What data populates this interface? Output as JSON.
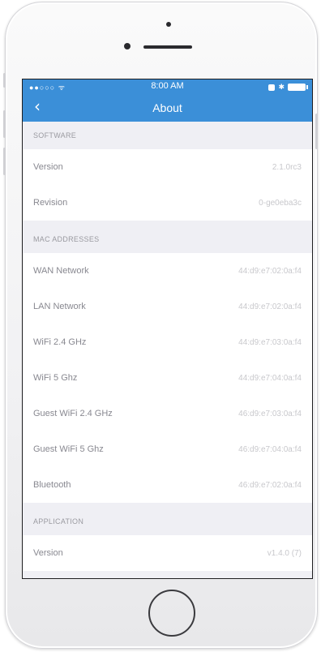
{
  "status": {
    "signal": "●●○○○ ",
    "wifi": "ᯤ",
    "time": "8:00 AM",
    "bluetooth": "✱"
  },
  "nav": {
    "back_glyph": "‹",
    "title": "About"
  },
  "sections": {
    "software": {
      "header": "SOFTWARE",
      "rows": [
        {
          "label": "Version",
          "value": "2.1.0rc3"
        },
        {
          "label": "Revision",
          "value": "0-ge0eba3c"
        }
      ]
    },
    "mac": {
      "header": "MAC ADDRESSES",
      "rows": [
        {
          "label": "WAN Network",
          "value": "44:d9:e7:02:0a:f4"
        },
        {
          "label": "LAN Network",
          "value": "44:d9:e7:02:0a:f4"
        },
        {
          "label": "WiFi 2.4 GHz",
          "value": "44:d9:e7:03:0a:f4"
        },
        {
          "label": "WiFi 5 Ghz",
          "value": "44:d9:e7:04:0a:f4"
        },
        {
          "label": "Guest WiFi 2.4 GHz",
          "value": "46:d9:e7:03:0a:f4"
        },
        {
          "label": "Guest WiFi 5 Ghz",
          "value": "46:d9:e7:04:0a:f4"
        },
        {
          "label": "Bluetooth",
          "value": "46:d9:e7:02:0a:f4"
        }
      ]
    },
    "application": {
      "header": "APPLICATION",
      "rows": [
        {
          "label": "Version",
          "value": "v1.4.0 (7)"
        }
      ]
    }
  },
  "colors": {
    "accent": "#3b8fd8",
    "background": "#efeff4"
  }
}
